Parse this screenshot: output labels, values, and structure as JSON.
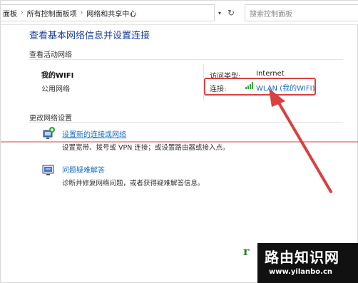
{
  "address_bar": {
    "breadcrumbs": [
      "面板",
      "所有控制面板项",
      "网络和共享中心"
    ],
    "search_placeholder": "搜索控制面板"
  },
  "main": {
    "title": "查看基本网络信息并设置连接",
    "active_section_label": "查看活动网络",
    "network": {
      "name": "我的WIFI",
      "profile": "公用网络",
      "access_type_label": "访问类型:",
      "access_type_value": "Internet",
      "connection_label": "连接:",
      "connection_value": "WLAN (我的WIFI)"
    },
    "change_section_label": "更改网络设置",
    "tasks": [
      {
        "label": "设置新的连接或网络",
        "description": "设置宽带、拨号或 VPN 连接；或设置路由器或接入点。"
      },
      {
        "label": "问题疑难解答",
        "description": "诊断并修复网络问题，或者获得疑难解答信息。"
      }
    ]
  },
  "annotation": {
    "color": "#d94040"
  },
  "watermark": {
    "glyph": "r",
    "title": "路由知识网",
    "url": "www.yilanbo.cn"
  },
  "colors": {
    "link": "#1a6ec0",
    "title": "#1a3e9a",
    "highlight": "#d94040"
  }
}
